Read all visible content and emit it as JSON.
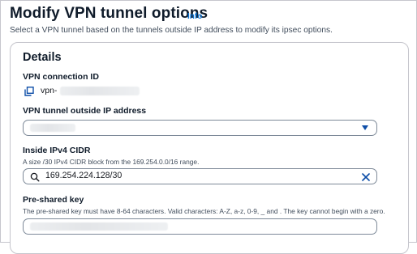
{
  "header": {
    "title": "Modify VPN tunnel options",
    "info_link": "Info",
    "description": "Select a VPN tunnel based on the tunnels outside IP address to modify its ipsec options."
  },
  "details": {
    "title": "Details",
    "vpn_connection": {
      "label": "VPN connection ID",
      "value": "vpn-",
      "icon": "copy-icon"
    },
    "tunnel_outside_ip": {
      "label": "VPN tunnel outside IP address",
      "selected_value": ""
    },
    "inside_cidr": {
      "label": "Inside IPv4 CIDR",
      "hint": "A size /30 IPv4 CIDR block from the 169.254.0.0/16 range.",
      "value": "169.254.224.128/30"
    },
    "pre_shared_key": {
      "label": "Pre-shared key",
      "hint": "The pre-shared key must have 8-64 characters. Valid characters: A-Z, a-z, 0-9, _ and . The key cannot begin with a zero.",
      "value": ""
    }
  },
  "colors": {
    "link": "#0972d3",
    "border": "#7d8998",
    "text": "#0f1b2a",
    "icon": "#0f4fa8"
  }
}
